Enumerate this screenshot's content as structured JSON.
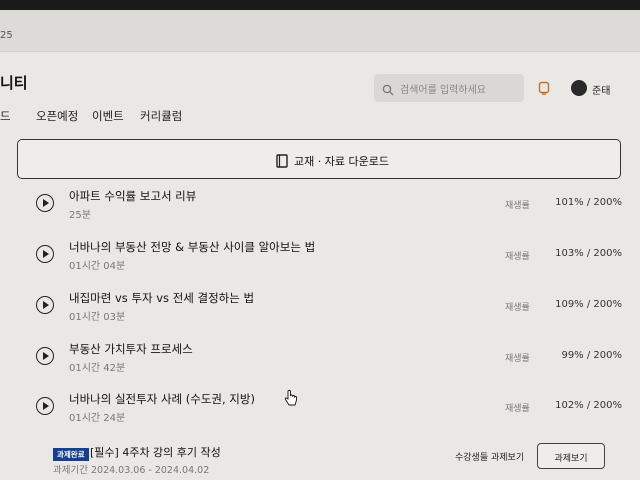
{
  "browser": {
    "url_fragment": "25"
  },
  "header": {
    "title": "니티",
    "search_placeholder": "검색어를 입력하세요",
    "user_name": "준태"
  },
  "nav": {
    "items": [
      "드",
      "오픈예정",
      "이벤트",
      "커리큘럼"
    ]
  },
  "download_button": {
    "label": "교재 · 자료 다운로드"
  },
  "lessons": [
    {
      "title": "아파트 수익률 보고서 리뷰",
      "duration": "25분",
      "rate_label": "재생률",
      "rate_value": "101% / 200%"
    },
    {
      "title": "너바나의 부동산 전망 & 부동산 사이클 알아보는 법",
      "duration": "01시간 04분",
      "rate_label": "재생률",
      "rate_value": "103% / 200%"
    },
    {
      "title": "내집마련 vs 투자 vs 전세 결정하는 법",
      "duration": "01시간 03분",
      "rate_label": "재생률",
      "rate_value": "109% / 200%"
    },
    {
      "title": "부동산 가치투자 프로세스",
      "duration": "01시간 42분",
      "rate_label": "재생률",
      "rate_value": "99% / 200%"
    },
    {
      "title": "너바나의 실전투자 사례 (수도권, 지방)",
      "duration": "01시간 24분",
      "rate_label": "재생률",
      "rate_value": "102% / 200%"
    }
  ],
  "assignment": {
    "badge": "과제완료",
    "title": "[필수] 4주차 강의 후기 작성",
    "period": "과제기간 2024.03.06 - 2024.04.02",
    "view_students_label": "수강생들 과제보기",
    "view_button_label": "과제보기"
  }
}
